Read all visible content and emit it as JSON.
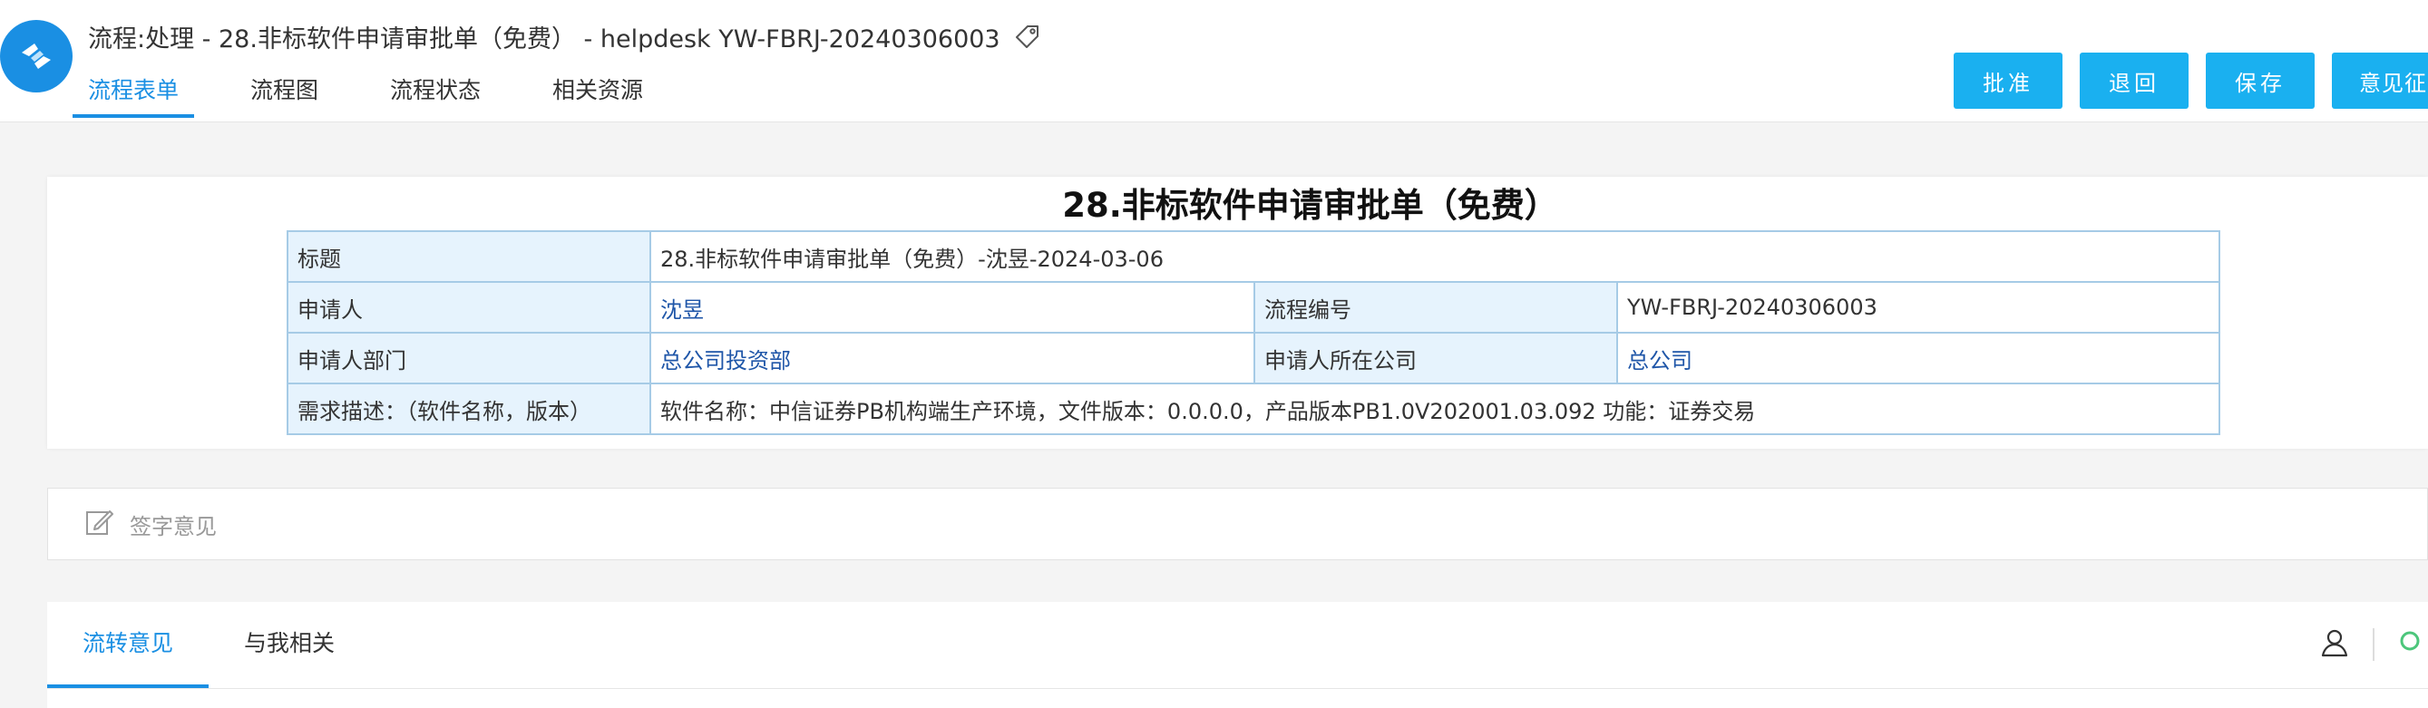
{
  "header": {
    "title": "流程:处理 - 28.非标软件申请审批单（免费） - helpdesk YW-FBRJ-20240306003",
    "tabs": [
      {
        "label": "流程表单",
        "active": true
      },
      {
        "label": "流程图",
        "active": false
      },
      {
        "label": "流程状态",
        "active": false
      },
      {
        "label": "相关资源",
        "active": false
      }
    ],
    "actions": {
      "approve": "批准",
      "return": "退回",
      "save": "保存",
      "opinion": "意见征"
    }
  },
  "form": {
    "title": "28.非标软件申请审批单（免费）",
    "rows": {
      "subject_label": "标题",
      "subject_value": "28.非标软件申请审批单（免费）-沈昱-2024-03-06",
      "applicant_label": "申请人",
      "applicant_value": "沈昱",
      "flow_no_label": "流程编号",
      "flow_no_value": "YW-FBRJ-20240306003",
      "dept_label": "申请人部门",
      "dept_value": "总公司投资部",
      "company_label": "申请人所在公司",
      "company_value": "总公司",
      "desc_label": "需求描述：（软件名称，版本）",
      "desc_value": "软件名称：中信证券PB机构端生产环境，文件版本：0.0.0.0，产品版本PB1.0V202001.03.092  功能：证券交易"
    }
  },
  "sign": {
    "placeholder": "签字意见"
  },
  "bottom_tabs": [
    {
      "label": "流转意见",
      "active": true
    },
    {
      "label": "与我相关",
      "active": false
    }
  ],
  "colors": {
    "accent": "#1a8fe3",
    "button": "#1ab0f0",
    "label_bg": "#e6f3fd",
    "border": "#a6cbe6",
    "link": "#1f56a8"
  },
  "icons": [
    "app-logo-icon",
    "tag-icon",
    "edit-icon",
    "user-icon",
    "search-icon"
  ]
}
